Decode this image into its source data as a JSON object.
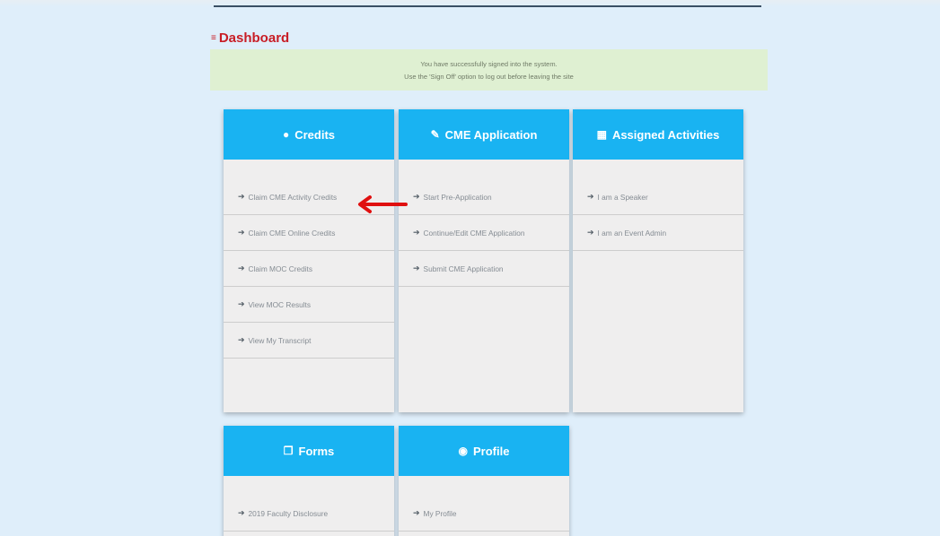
{
  "page": {
    "title": "Dashboard"
  },
  "alert": {
    "line1": "You have successfully signed into the system.",
    "line2": "Use the 'Sign Off' option to log out before leaving the site"
  },
  "cards": {
    "credits": {
      "title": "Credits",
      "items": [
        "Claim CME Activity Credits",
        "Claim CME Online Credits",
        "Claim MOC Credits",
        "View MOC Results",
        "View My Transcript"
      ]
    },
    "cme": {
      "title": "CME Application",
      "items": [
        "Start Pre-Application",
        "Continue/Edit CME Application",
        "Submit CME Application"
      ]
    },
    "assigned": {
      "title": "Assigned Activities",
      "items": [
        "I am a Speaker",
        "I am an Event Admin"
      ]
    },
    "forms": {
      "title": "Forms",
      "items": [
        "2019 Faculty Disclosure"
      ]
    },
    "profile": {
      "title": "Profile",
      "items": [
        "My Profile"
      ]
    }
  },
  "icons": {
    "credits": "circle-icon",
    "cme": "pencil-icon",
    "assigned": "table-icon",
    "forms": "copy-icon",
    "profile": "user-circle-icon",
    "item": "arrow-right-icon"
  },
  "colors": {
    "accent": "#19b3f2",
    "title": "#c81d25",
    "alert_bg": "#dff0d2",
    "callout": "#e01010"
  }
}
